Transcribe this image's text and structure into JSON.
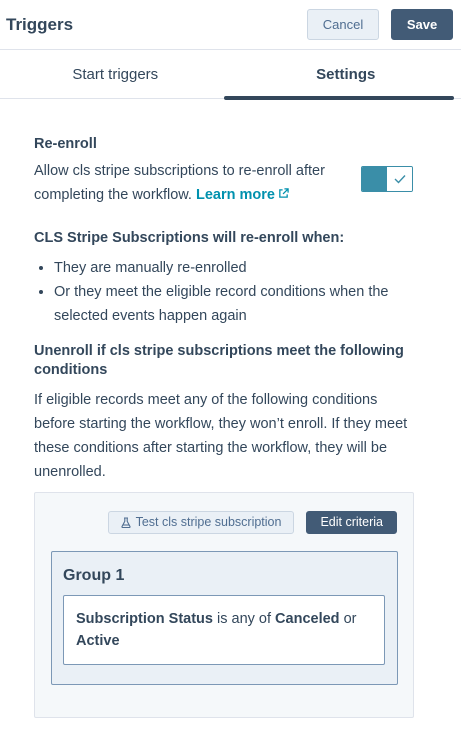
{
  "header": {
    "title": "Triggers",
    "cancel_label": "Cancel",
    "save_label": "Save"
  },
  "tabs": [
    {
      "label": "Start triggers",
      "active": false
    },
    {
      "label": "Settings",
      "active": true
    }
  ],
  "reenroll": {
    "title": "Re-enroll",
    "description": "Allow cls stripe subscriptions to re-enroll after completing the workflow.",
    "learn_more": "Learn more",
    "toggle_on": true,
    "when_title": "CLS Stripe Subscriptions will re-enroll when:",
    "bullets": [
      "They are manually re-enrolled",
      "Or they meet the eligible record conditions when the selected events happen again"
    ]
  },
  "unenroll": {
    "title": "Unenroll if cls stripe subscriptions meet the following conditions",
    "description": "If eligible records meet any of the following conditions before starting the workflow, they won’t enroll. If they meet these conditions after starting the workflow, they will be unenrolled."
  },
  "criteria": {
    "test_label": "Test cls stripe subscription",
    "edit_label": "Edit criteria",
    "group_title": "Group 1",
    "condition": {
      "property": "Subscription Status",
      "operator": "is any of",
      "value1": "Canceled",
      "joiner": "or",
      "value2": "Active"
    }
  },
  "colors": {
    "text": "#33475b",
    "link": "#0091ae",
    "primary_button": "#425b76",
    "toggle": "#3a8ea8"
  }
}
